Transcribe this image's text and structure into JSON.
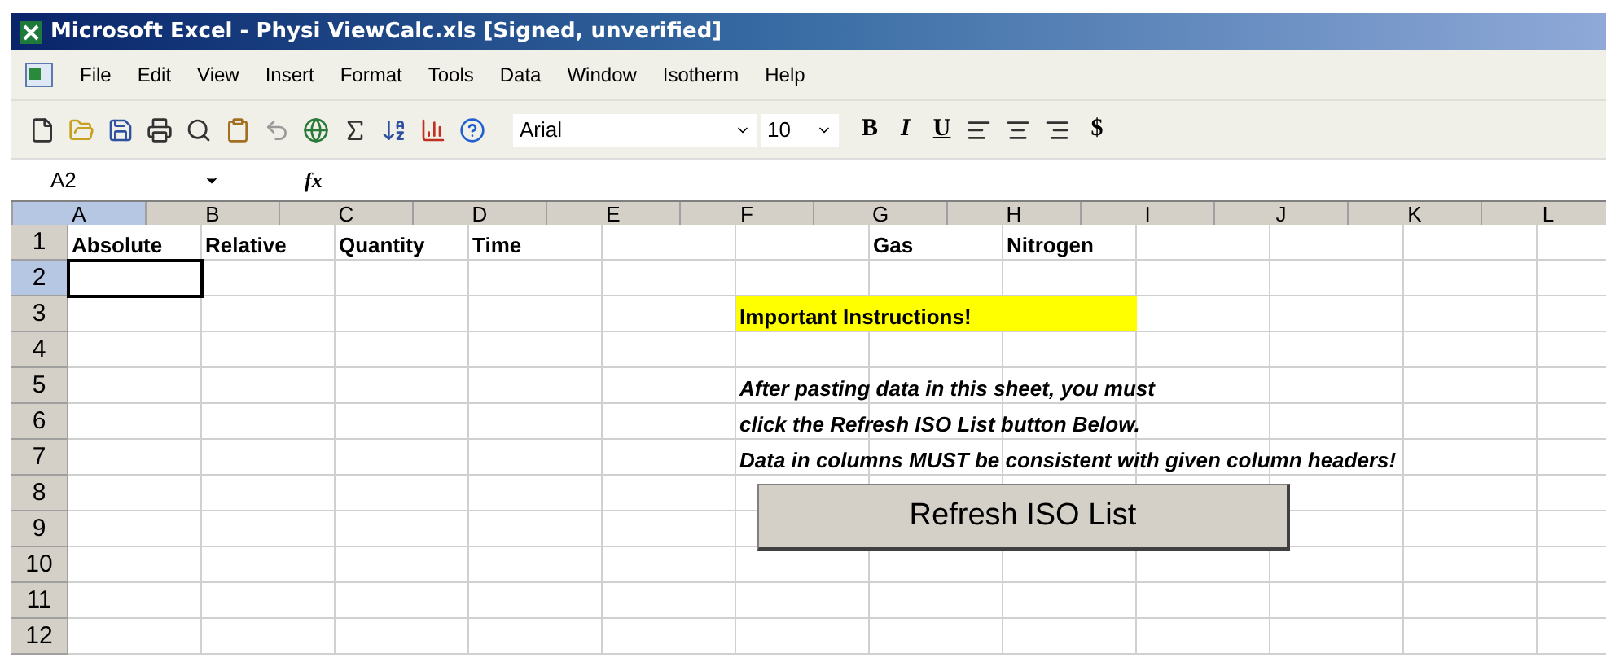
{
  "window": {
    "title": "Microsoft Excel - Physi ViewCalc.xls  [Signed, unverified]"
  },
  "menu": [
    "File",
    "Edit",
    "View",
    "Insert",
    "Format",
    "Tools",
    "Data",
    "Window",
    "Isotherm",
    "Help"
  ],
  "toolbar": {
    "font": "Arial",
    "size": "10",
    "format_buttons": [
      {
        "label": "B",
        "kind": "bold"
      },
      {
        "label": "I",
        "kind": "italic"
      },
      {
        "label": "U",
        "kind": "underline"
      }
    ],
    "currency": "$"
  },
  "formula_bar": {
    "name_box": "A2",
    "fx": "fx"
  },
  "sheet": {
    "columns": [
      {
        "label": "A",
        "selected": true
      },
      {
        "label": "B",
        "selected": false
      },
      {
        "label": "C",
        "selected": false
      },
      {
        "label": "D",
        "selected": false
      },
      {
        "label": "E",
        "selected": false
      },
      {
        "label": "F",
        "selected": false
      },
      {
        "label": "G",
        "selected": false
      },
      {
        "label": "H",
        "selected": false
      },
      {
        "label": "I",
        "selected": false
      },
      {
        "label": "J",
        "selected": false
      },
      {
        "label": "K",
        "selected": false
      },
      {
        "label": "L",
        "selected": false
      }
    ],
    "rows": [
      {
        "number": "1",
        "selected": false,
        "cells": [
          {
            "text": "Absolute",
            "kind": "heading"
          },
          {
            "text": "Relative",
            "kind": "heading"
          },
          {
            "text": "Quantity",
            "kind": "heading"
          },
          {
            "text": "Time",
            "kind": "heading"
          },
          {},
          {},
          {
            "text": "Gas",
            "kind": "heading"
          },
          {
            "text": "Nitrogen",
            "kind": "heading"
          },
          {},
          {},
          {},
          {}
        ]
      },
      {
        "number": "2",
        "selected": true,
        "cells": [
          {},
          {},
          {},
          {},
          {},
          {},
          {},
          {},
          {},
          {},
          {},
          {}
        ]
      },
      {
        "number": "3",
        "selected": false,
        "cells": [
          {},
          {},
          {},
          {},
          {},
          {
            "text": "Important Instructions!",
            "kind": "heading",
            "highlight": true
          },
          {
            "highlight": true
          },
          {
            "highlight": true
          },
          {},
          {},
          {},
          {}
        ]
      },
      {
        "number": "4",
        "selected": false,
        "cells": [
          {},
          {},
          {},
          {},
          {},
          {},
          {},
          {},
          {},
          {},
          {},
          {}
        ]
      },
      {
        "number": "5",
        "selected": false,
        "cells": [
          {},
          {},
          {},
          {},
          {},
          {
            "text": "After pasting data in this sheet, you must",
            "kind": "emphasis"
          },
          {},
          {},
          {},
          {},
          {},
          {}
        ]
      },
      {
        "number": "6",
        "selected": false,
        "cells": [
          {},
          {},
          {},
          {},
          {},
          {
            "text": "click the Refresh ISO List button Below.",
            "kind": "emphasis"
          },
          {},
          {},
          {},
          {},
          {},
          {}
        ]
      },
      {
        "number": "7",
        "selected": false,
        "cells": [
          {},
          {},
          {},
          {},
          {},
          {
            "text": "Data in columns MUST be consistent with given column headers!",
            "kind": "emphasis"
          },
          {},
          {},
          {},
          {},
          {},
          {}
        ]
      },
      {
        "number": "8",
        "selected": false,
        "cells": [
          {},
          {},
          {},
          {},
          {},
          {},
          {},
          {},
          {},
          {},
          {},
          {}
        ]
      },
      {
        "number": "9",
        "selected": false,
        "cells": [
          {},
          {},
          {},
          {},
          {},
          {},
          {},
          {},
          {},
          {},
          {},
          {}
        ]
      },
      {
        "number": "10",
        "selected": false,
        "cells": [
          {},
          {},
          {},
          {},
          {},
          {},
          {},
          {},
          {},
          {},
          {},
          {}
        ]
      },
      {
        "number": "11",
        "selected": false,
        "cells": [
          {},
          {},
          {},
          {},
          {},
          {},
          {},
          {},
          {},
          {},
          {},
          {}
        ]
      },
      {
        "number": "12",
        "selected": false,
        "cells": [
          {},
          {},
          {},
          {},
          {},
          {},
          {},
          {},
          {},
          {},
          {},
          {}
        ]
      }
    ],
    "button": "Refresh ISO List"
  }
}
